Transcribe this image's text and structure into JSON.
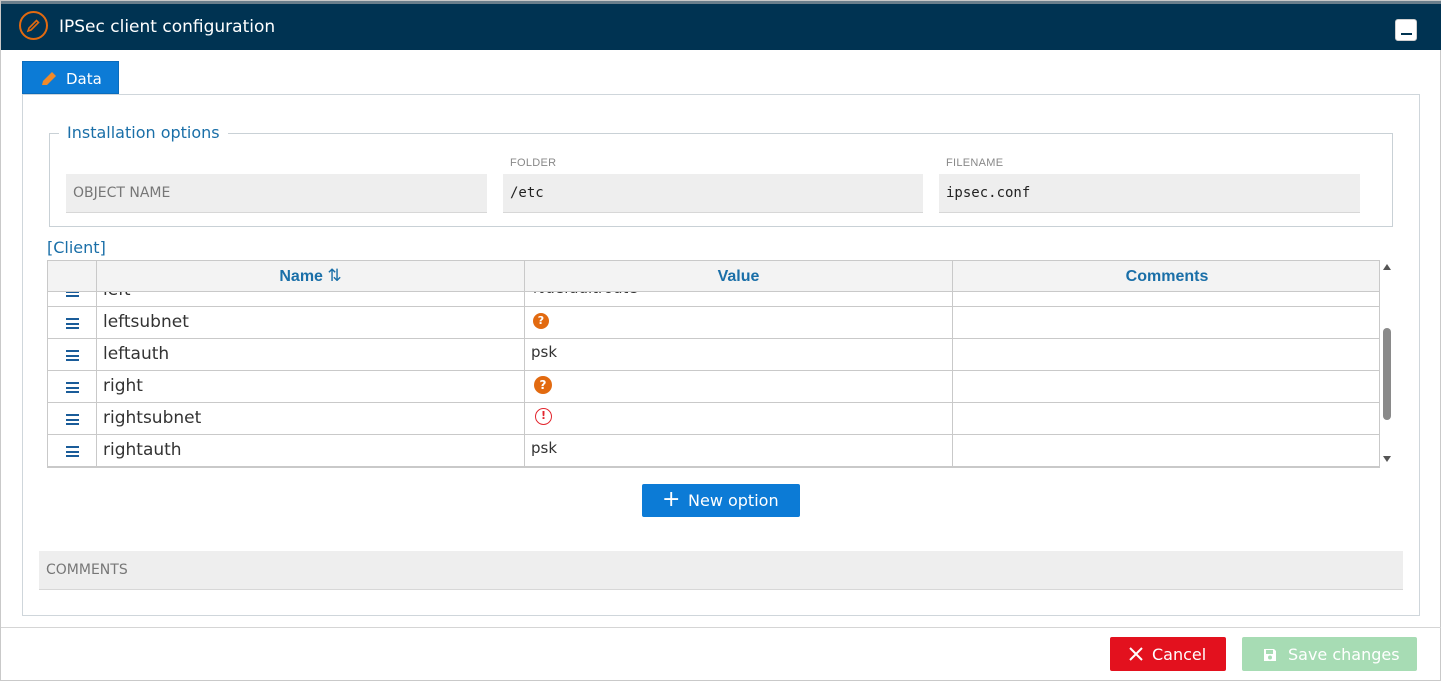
{
  "window": {
    "title": "IPSec client configuration"
  },
  "tabs": [
    {
      "label": "Data"
    }
  ],
  "installation": {
    "legend": "Installation options",
    "object_name": {
      "placeholder": "OBJECT NAME",
      "value": ""
    },
    "folder": {
      "label": "FOLDER",
      "value": "/etc"
    },
    "filename": {
      "label": "FILENAME",
      "value": "ipsec.conf"
    }
  },
  "client": {
    "title": "[Client]",
    "columns": {
      "name": "Name",
      "value": "Value",
      "comments": "Comments"
    },
    "rows": [
      {
        "name": "left",
        "value": "%defaultroute",
        "status": "text"
      },
      {
        "name": "leftsubnet",
        "value": "",
        "status": "question"
      },
      {
        "name": "leftauth",
        "value": "psk",
        "status": "text"
      },
      {
        "name": "right",
        "value": "",
        "status": "question"
      },
      {
        "name": "rightsubnet",
        "value": "",
        "status": "error"
      },
      {
        "name": "rightauth",
        "value": "psk",
        "status": "text"
      }
    ]
  },
  "icons": {
    "question": "?",
    "error": "!",
    "sort": "⇅",
    "plus": "+"
  },
  "buttons": {
    "new_option": "New option",
    "cancel": "Cancel",
    "save": "Save changes"
  },
  "comments": {
    "placeholder": "COMMENTS"
  },
  "colors": {
    "titlebar": "#003352",
    "accent": "#0c7bd6",
    "danger": "#e3111e",
    "success_disabled": "#a7dcb4",
    "warning": "#e26a10"
  }
}
